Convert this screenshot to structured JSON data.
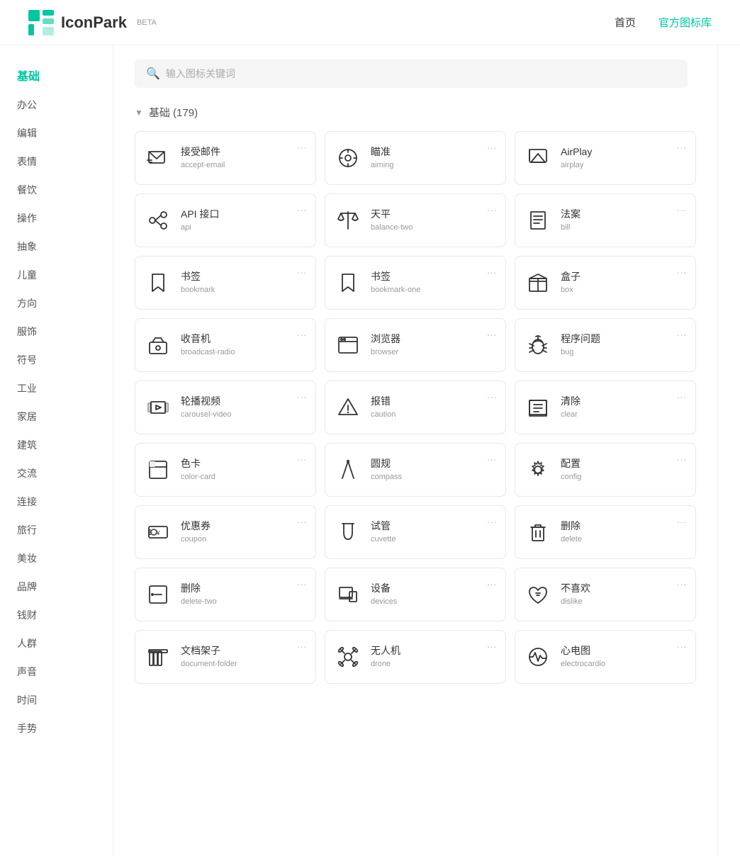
{
  "header": {
    "logo_text": "IconPark",
    "logo_beta": "BETA",
    "nav_home": "首页",
    "nav_library": "官方图标库"
  },
  "sidebar": {
    "items": [
      {
        "label": "基础",
        "active": true
      },
      {
        "label": "办公",
        "active": false
      },
      {
        "label": "编辑",
        "active": false
      },
      {
        "label": "表情",
        "active": false
      },
      {
        "label": "餐饮",
        "active": false
      },
      {
        "label": "操作",
        "active": false
      },
      {
        "label": "抽象",
        "active": false
      },
      {
        "label": "儿童",
        "active": false
      },
      {
        "label": "方向",
        "active": false
      },
      {
        "label": "服饰",
        "active": false
      },
      {
        "label": "符号",
        "active": false
      },
      {
        "label": "工业",
        "active": false
      },
      {
        "label": "家居",
        "active": false
      },
      {
        "label": "建筑",
        "active": false
      },
      {
        "label": "交流",
        "active": false
      },
      {
        "label": "连接",
        "active": false
      },
      {
        "label": "旅行",
        "active": false
      },
      {
        "label": "美妆",
        "active": false
      },
      {
        "label": "品牌",
        "active": false
      },
      {
        "label": "钱财",
        "active": false
      },
      {
        "label": "人群",
        "active": false
      },
      {
        "label": "声音",
        "active": false
      },
      {
        "label": "时间",
        "active": false
      },
      {
        "label": "手势",
        "active": false
      }
    ]
  },
  "search": {
    "placeholder": "输入图标关键词"
  },
  "category": {
    "label": "基础 (179)"
  },
  "icons": [
    {
      "zh": "接受邮件",
      "en": "accept-email"
    },
    {
      "zh": "瞄准",
      "en": "aiming"
    },
    {
      "zh": "AirPlay",
      "en": "airplay"
    },
    {
      "zh": "API 接口",
      "en": "api"
    },
    {
      "zh": "天平",
      "en": "balance-two"
    },
    {
      "zh": "法案",
      "en": "bill"
    },
    {
      "zh": "书签",
      "en": "bookmark"
    },
    {
      "zh": "书签",
      "en": "bookmark-one"
    },
    {
      "zh": "盒子",
      "en": "box"
    },
    {
      "zh": "收音机",
      "en": "broadcast-radio"
    },
    {
      "zh": "浏览器",
      "en": "browser"
    },
    {
      "zh": "程序问题",
      "en": "bug"
    },
    {
      "zh": "轮播视频",
      "en": "carousel-video"
    },
    {
      "zh": "报错",
      "en": "caution"
    },
    {
      "zh": "清除",
      "en": "clear"
    },
    {
      "zh": "色卡",
      "en": "color-card"
    },
    {
      "zh": "圆规",
      "en": "compass"
    },
    {
      "zh": "配置",
      "en": "config"
    },
    {
      "zh": "优惠券",
      "en": "coupon"
    },
    {
      "zh": "试管",
      "en": "cuvette"
    },
    {
      "zh": "删除",
      "en": "delete"
    },
    {
      "zh": "删除",
      "en": "delete-two"
    },
    {
      "zh": "设备",
      "en": "devices"
    },
    {
      "zh": "不喜欢",
      "en": "dislike"
    },
    {
      "zh": "文档架子",
      "en": "document-folder"
    },
    {
      "zh": "无人机",
      "en": "drone"
    },
    {
      "zh": "心电图",
      "en": "electrocardio"
    }
  ],
  "more_label": "..."
}
